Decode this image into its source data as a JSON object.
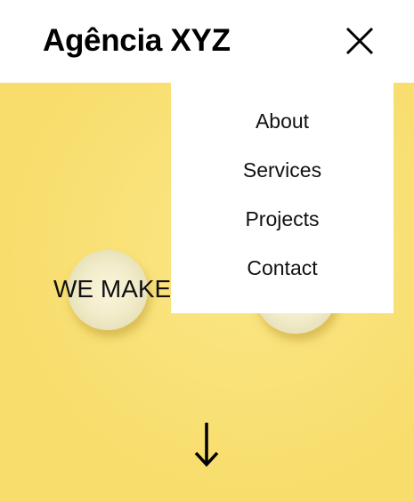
{
  "header": {
    "brand": "Agência XYZ",
    "close_icon": "close-icon"
  },
  "menu": {
    "items": [
      {
        "label": "About"
      },
      {
        "label": "Services"
      },
      {
        "label": "Projects"
      },
      {
        "label": "Contact"
      }
    ]
  },
  "hero": {
    "headline": "WE MAKE",
    "scroll_icon": "arrow-down-icon"
  },
  "colors": {
    "hero_background": "#f8dd6c",
    "header_background": "#ffffff",
    "menu_background": "#ffffff",
    "text": "#000000"
  }
}
